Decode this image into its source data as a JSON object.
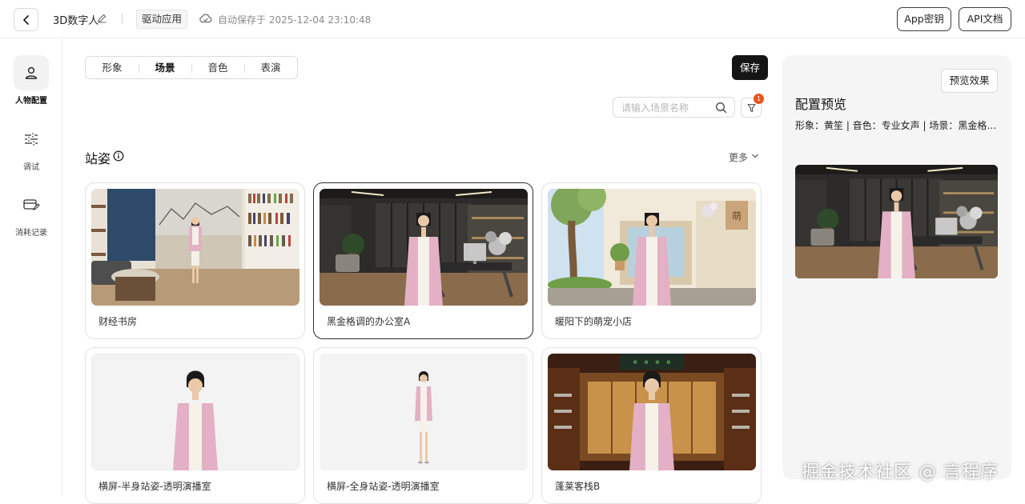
{
  "header": {
    "back_icon": "chevron-left-icon",
    "app_title": "3D数字人",
    "drive_tag": "驱动应用",
    "autosave_text": "自动保存于 2025-12-04 23:10:48",
    "app_key_label": "App密钥",
    "api_doc_label": "API文档"
  },
  "sidebar": {
    "items": [
      {
        "label": "人物配置",
        "icon": "person-icon",
        "active": true
      },
      {
        "label": "调试",
        "icon": "sliders-icon",
        "active": false
      },
      {
        "label": "消耗记录",
        "icon": "card-edit-icon",
        "active": false
      }
    ]
  },
  "main": {
    "tabs": [
      {
        "label": "形象",
        "active": false
      },
      {
        "label": "场景",
        "active": true
      },
      {
        "label": "音色",
        "active": false
      },
      {
        "label": "表演",
        "active": false
      }
    ],
    "save_label": "保存",
    "search": {
      "placeholder": "请输入场景名称",
      "value": ""
    },
    "filter_badge": "1",
    "section_title": "站姿",
    "more_label": "更多",
    "scenes": [
      {
        "label": "财经书房",
        "selected": false
      },
      {
        "label": "黑金格调的办公室A",
        "selected": true
      },
      {
        "label": "暖阳下的萌宠小店",
        "selected": false
      },
      {
        "label": "横屏-半身站姿-透明演播室",
        "selected": false
      },
      {
        "label": "横屏-全身站姿-透明演播室",
        "selected": false
      },
      {
        "label": "蓬莱客栈B",
        "selected": false
      }
    ]
  },
  "preview": {
    "button_label": "预览效果",
    "title": "配置预览",
    "summary": "形象：黄笙 | 音色：专业女声 | 场景：黑金格调的办公室A"
  },
  "watermark": "掘金技术社区 @ 言程序",
  "colors": {
    "primary_dark": "#151515",
    "badge": "#e8541e",
    "panel_bg": "#f5f5f5",
    "jacket_pink": "#e3b0c5"
  }
}
